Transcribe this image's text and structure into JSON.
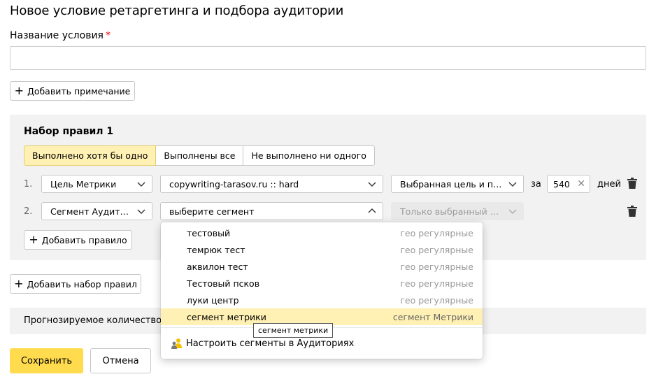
{
  "page": {
    "title": "Новое условие ретаргетинга и подбора аудитории",
    "name_label": "Название условия",
    "required_mark": "*",
    "name_value": "",
    "add_note_label": "Добавить примечание"
  },
  "ruleset": {
    "title": "Набор правил 1",
    "modes": [
      {
        "label": "Выполнено хотя бы одно",
        "active": true
      },
      {
        "label": "Выполнены все",
        "active": false
      },
      {
        "label": "Не выполнено ни одного",
        "active": false
      }
    ],
    "rules": [
      {
        "number": "1.",
        "type": "Цель Метрики",
        "goal": "copywriting-tarasov.ru :: hard",
        "mode": "Выбранная цель и похо…",
        "period_prefix": "за",
        "period_value": "540",
        "period_suffix": "дней"
      },
      {
        "number": "2.",
        "type": "Сегмент Аудиторий",
        "segment_placeholder": "выберите сегмент",
        "mode": "Только выбранный сег…"
      }
    ],
    "add_rule_label": "Добавить правило"
  },
  "add_ruleset_label": "Добавить набор правил",
  "forecast_label": "Прогнозируемое количество по",
  "footer": {
    "save_label": "Сохранить",
    "cancel_label": "Отмена"
  },
  "dropdown": {
    "items": [
      {
        "name": "тестовый",
        "tag": "гео регулярные"
      },
      {
        "name": "темрюк тест",
        "tag": "гео регулярные"
      },
      {
        "name": "аквилон тест",
        "tag": "гео регулярные"
      },
      {
        "name": "Тестовый псков",
        "tag": "гео регулярные"
      },
      {
        "name": "луки центр",
        "tag": "гео регулярные"
      },
      {
        "name": "сегмент метрики",
        "tag": "сегмент Метрики",
        "highlighted": true
      }
    ],
    "configure_link": "Настроить сегменты в Аудиториях",
    "tooltip": "сегмент метрики"
  },
  "colors": {
    "accent_yellow": "#ffdb4d",
    "active_segment": "#fff0b3",
    "panel_bg": "#f2f2f2",
    "required": "#e60000"
  },
  "icons": [
    "plus-icon",
    "chevron-down-icon",
    "chevron-up-icon",
    "clear-icon",
    "trash-icon",
    "audience-icon"
  ]
}
